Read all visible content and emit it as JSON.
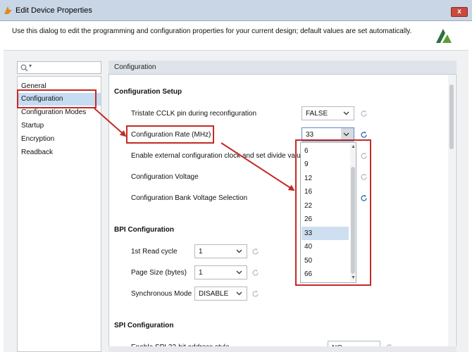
{
  "window": {
    "title": "Edit Device Properties",
    "close_glyph": "x",
    "description": "Use this dialog to edit the programming and configuration properties for your current design; default values are set automatically."
  },
  "search": {
    "placeholder": ""
  },
  "nav": {
    "items": [
      {
        "label": "General",
        "selected": false
      },
      {
        "label": "Configuration",
        "selected": true
      },
      {
        "label": "Configuration Modes",
        "selected": false
      },
      {
        "label": "Startup",
        "selected": false
      },
      {
        "label": "Encryption",
        "selected": false
      },
      {
        "label": "Readback",
        "selected": false
      }
    ]
  },
  "panel": {
    "header": "Configuration",
    "config_setup": {
      "title": "Configuration Setup",
      "tristate_label": "Tristate CCLK pin during reconfiguration",
      "tristate_value": "FALSE",
      "rate_label": "Configuration Rate (MHz)",
      "rate_value": "33",
      "ext_clock_label": "Enable external configuration clock and set divide value",
      "voltage_label": "Configuration Voltage",
      "bank_voltage_label": "Configuration Bank Voltage Selection"
    },
    "bpi": {
      "title": "BPI Configuration",
      "first_read_label": "1st Read cycle",
      "first_read_value": "1",
      "page_size_label": "Page Size (bytes)",
      "page_size_value": "1",
      "sync_mode_label": "Synchronous Mode",
      "sync_mode_value": "DISABLE"
    },
    "spi": {
      "title": "SPI Configuration",
      "addr_label": "Enable SPI 32-bit address style",
      "addr_value": "NO"
    }
  },
  "rate_dropdown": {
    "options": [
      "6",
      "9",
      "12",
      "16",
      "22",
      "26",
      "33",
      "40",
      "50",
      "66"
    ],
    "selected": "33"
  },
  "colors": {
    "highlight": "#c42b25",
    "selection": "#c6dcf3",
    "reset_active": "#2a6cb3",
    "reset_inactive": "#b9bec4"
  }
}
